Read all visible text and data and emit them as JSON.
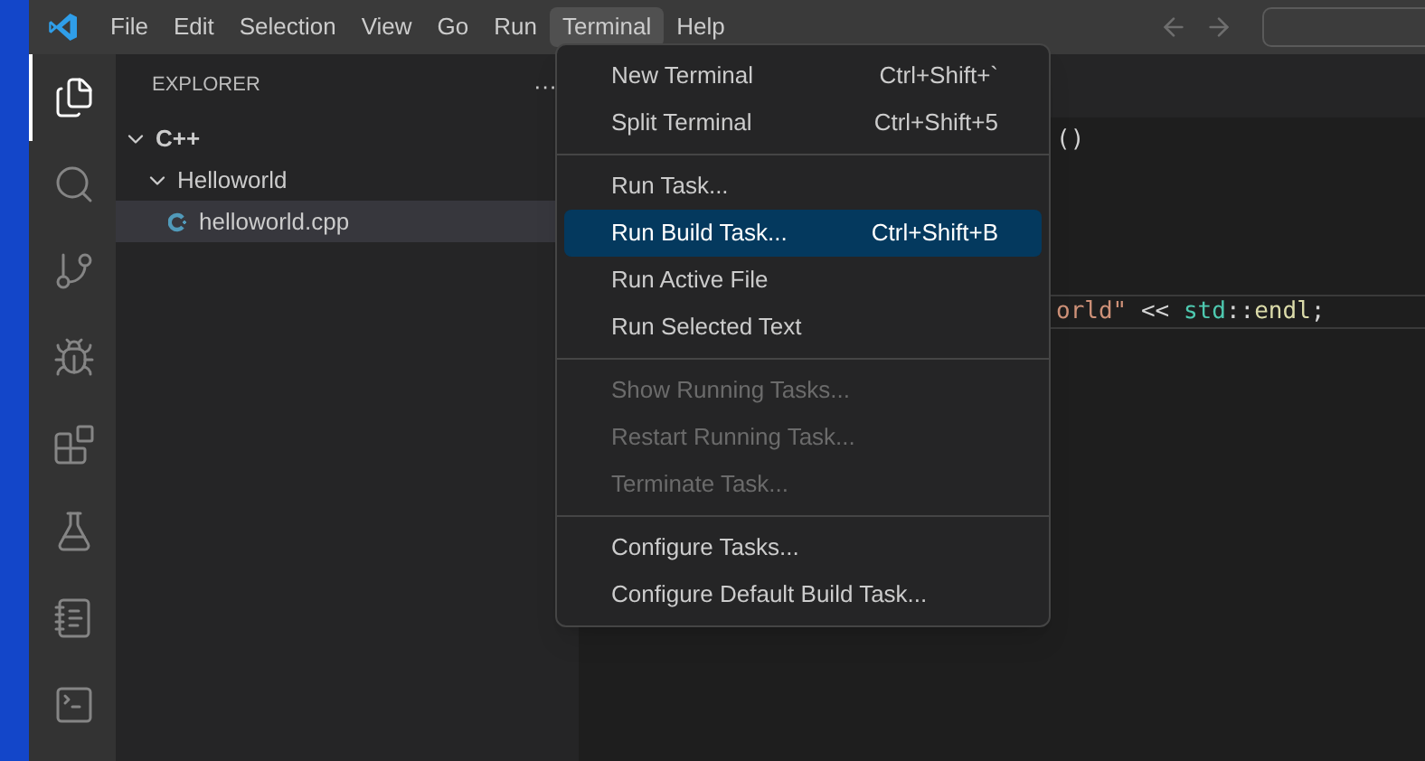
{
  "menubar": [
    {
      "label": "File",
      "selected": false
    },
    {
      "label": "Edit",
      "selected": false
    },
    {
      "label": "Selection",
      "selected": false
    },
    {
      "label": "View",
      "selected": false
    },
    {
      "label": "Go",
      "selected": false
    },
    {
      "label": "Run",
      "selected": false
    },
    {
      "label": "Terminal",
      "selected": true
    },
    {
      "label": "Help",
      "selected": false
    }
  ],
  "activity_bar": [
    {
      "kind": "files",
      "selected": true
    },
    {
      "kind": "search",
      "selected": false
    },
    {
      "kind": "source",
      "selected": false
    },
    {
      "kind": "debug",
      "selected": false
    },
    {
      "kind": "extensions",
      "selected": false
    },
    {
      "kind": "testing",
      "selected": false
    },
    {
      "kind": "notebook",
      "selected": false
    },
    {
      "kind": "terminal",
      "selected": false
    }
  ],
  "sidebar": {
    "title": "EXPLORER",
    "more": "···",
    "tree": [
      {
        "label": "C++",
        "expanded": true,
        "selected": false,
        "children": [
          {
            "label": "Helloworld",
            "expanded": true,
            "selected": false,
            "children": [
              {
                "label": "helloworld.cpp",
                "kind": "cpp",
                "selected": true
              }
            ]
          }
        ]
      }
    ]
  },
  "editor": {
    "lines": [
      {
        "current": false,
        "tokens": [
          {
            "text": "()",
            "color": "#d4d4d4"
          }
        ]
      },
      {
        "current": false
      },
      {
        "current": false
      },
      {
        "current": false
      },
      {
        "current": false
      },
      {
        "current": true,
        "tokens": [
          {
            "text": "orld\"",
            "color": "#ce9178"
          },
          {
            "text": " << ",
            "color": "#d4d4d4"
          },
          {
            "text": "std",
            "color": "#4ec9b0"
          },
          {
            "text": "::",
            "color": "#d4d4d4"
          },
          {
            "text": "endl",
            "color": "#dcdcaa"
          },
          {
            "text": ";",
            "color": "#d4d4d4"
          }
        ]
      }
    ]
  },
  "menu": {
    "sections": [
      [
        {
          "label": "New Terminal",
          "shortcut": "Ctrl+Shift+`",
          "disabled": false,
          "selected": false
        },
        {
          "label": "Split Terminal",
          "shortcut": "Ctrl+Shift+5",
          "disabled": false,
          "selected": false
        }
      ],
      [
        {
          "label": "Run Task...",
          "disabled": false,
          "selected": false
        },
        {
          "label": "Run Build Task...",
          "shortcut": "Ctrl+Shift+B",
          "disabled": false,
          "selected": true
        },
        {
          "label": "Run Active File",
          "disabled": false,
          "selected": false
        },
        {
          "label": "Run Selected Text",
          "disabled": false,
          "selected": false
        }
      ],
      [
        {
          "label": "Show Running Tasks...",
          "disabled": true,
          "selected": false
        },
        {
          "label": "Restart Running Task...",
          "disabled": true,
          "selected": false
        },
        {
          "label": "Terminate Task...",
          "disabled": true,
          "selected": false
        }
      ],
      [
        {
          "label": "Configure Tasks...",
          "disabled": false,
          "selected": false
        },
        {
          "label": "Configure Default Build Task...",
          "disabled": false,
          "selected": false
        }
      ]
    ]
  }
}
